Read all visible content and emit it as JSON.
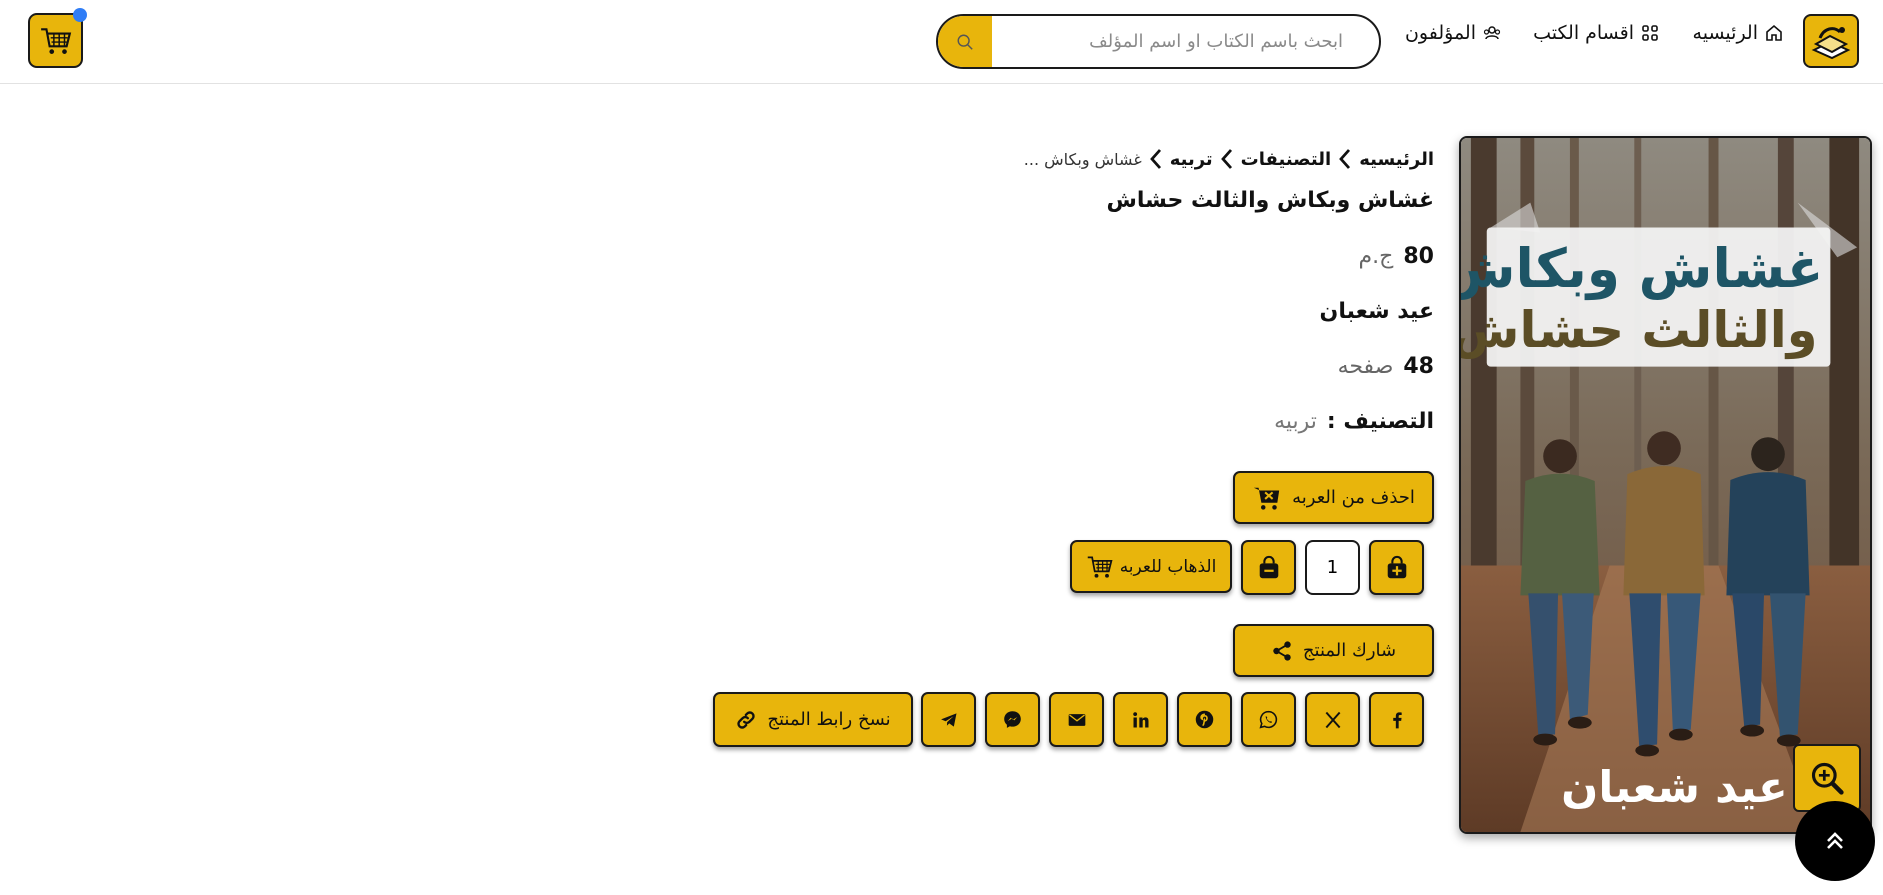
{
  "header": {
    "nav": {
      "home": "الرئيسيه",
      "categories": "اقسام الكتب",
      "authors": "المؤلفون"
    },
    "search_placeholder": "ابحث باسم الكتاب او اسم المؤلف",
    "cart_badge_color": "#2f7df6"
  },
  "breadcrumb": {
    "home": "الرئيسيه",
    "classifications": "التصنيفات",
    "category": "تربيه",
    "current": "غشاش وبكاش ..."
  },
  "product": {
    "title": "غشاش وبكاش والثالث حشاش",
    "price": "80",
    "currency": "ج.م",
    "author": "عيد شعبان",
    "pages": "48",
    "pages_unit": "صفحه",
    "category_label": "التصنيف :",
    "category_value": "تربيه",
    "cover": {
      "title_line1": "غشاش وبكاش",
      "title_line2": "والثالث حشاش",
      "author": "عيد شعبان"
    }
  },
  "actions": {
    "remove_from_cart": "احذف من العربه",
    "quantity": "1",
    "go_to_cart": "الذهاب للعربه",
    "share": "شارك المنتج",
    "copy_link": "نسخ رابط المنتج"
  },
  "share_icons": [
    "facebook-icon",
    "x-icon",
    "whatsapp-icon",
    "pinterest-icon",
    "linkedin-icon",
    "email-icon",
    "messenger-icon",
    "telegram-icon"
  ],
  "colors": {
    "accent": "#e8b50c",
    "border": "#1a1a1a"
  }
}
